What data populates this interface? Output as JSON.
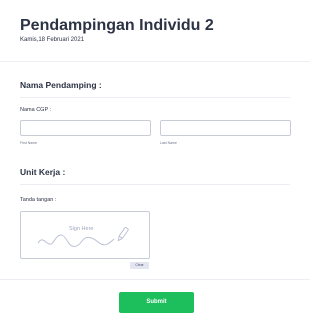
{
  "form": {
    "title": "Pendampingan Individu 2",
    "subtitle": "Kamis,18 Februari 2021"
  },
  "section_pendamping": {
    "heading": "Nama Pendamping :",
    "field_label": "Nama CGP :",
    "first_name": {
      "value": "",
      "sublabel": "First Name"
    },
    "last_name": {
      "value": "",
      "sublabel": "Last Name"
    }
  },
  "section_unit": {
    "heading": "Unit Kerja :"
  },
  "signature": {
    "label": "Tanda tangan :",
    "hint": "Sign Here",
    "clear_label": "Clear"
  },
  "submit_label": "Submit"
}
